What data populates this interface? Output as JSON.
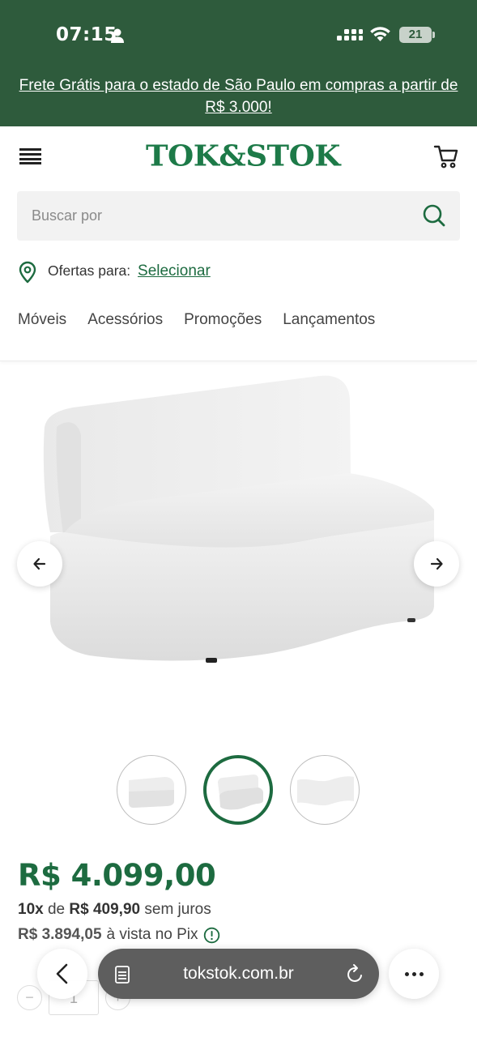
{
  "status_bar": {
    "time": "07:15",
    "battery": "21"
  },
  "promo_banner": {
    "text": "Frete Grátis para o estado de São Paulo em compras a partir de R$ 3.000!"
  },
  "header": {
    "logo": "TOK&STOK",
    "search_placeholder": "Buscar por",
    "offers_label": "Ofertas para:",
    "offers_link": "Selecionar"
  },
  "nav": {
    "items": [
      "Móveis",
      "Acessórios",
      "Promoções",
      "Lançamentos"
    ]
  },
  "gallery": {
    "thumbnail_count": 3,
    "active_thumbnail": 2
  },
  "product": {
    "price": "R$ 4.099,00",
    "installments_count": "10x",
    "installments_de": "de",
    "installment_value": "R$ 409,90",
    "installments_suffix": "sem juros",
    "pix_price": "R$ 3.894,05",
    "pix_label": "à vista no Pix",
    "quantity": "1"
  },
  "browser": {
    "url": "tokstok.com.br"
  },
  "colors": {
    "top_green": "#2e5b3c",
    "brand_green": "#1d7a48",
    "price_green": "#1d6b40"
  }
}
